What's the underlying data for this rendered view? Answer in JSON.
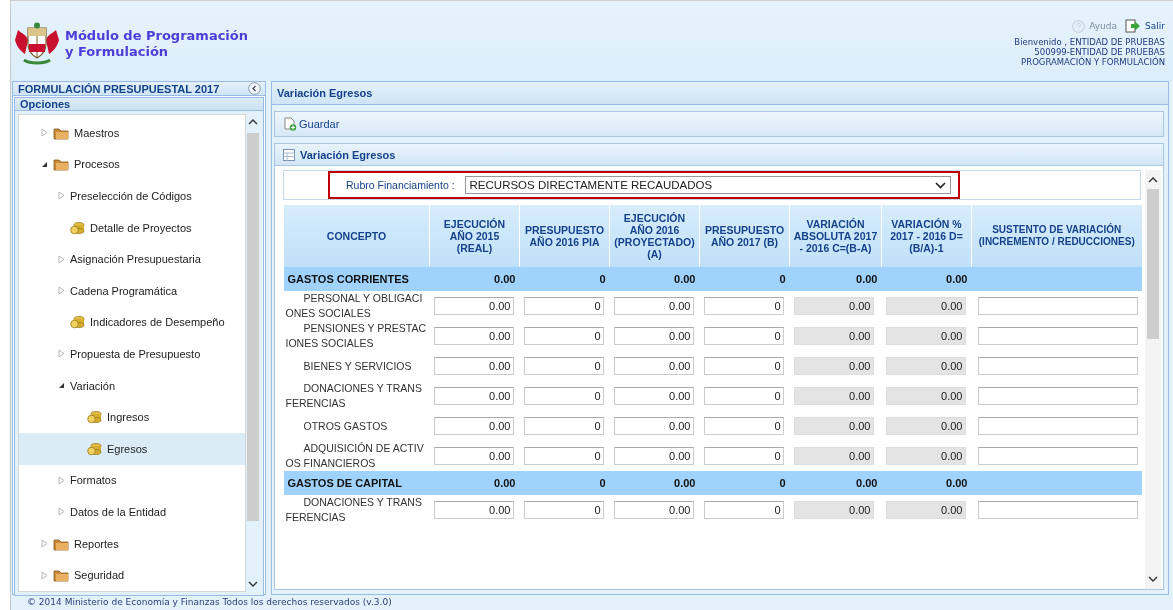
{
  "header": {
    "title": "Módulo de Programación y Formulación",
    "links": [
      {
        "label": "Ayuda",
        "kind": "help",
        "disabled": true
      },
      {
        "label": "Salir",
        "kind": "exit",
        "disabled": false
      }
    ],
    "user_lines": [
      "Bienvenido , ENTIDAD DE PRUEBAS",
      "500999-ENTIDAD DE PRUEBAS",
      "PROGRAMACIÓN Y FORMULACIÓN"
    ]
  },
  "sidebar": {
    "title": "FORMULACIÓN PRESUPUESTAL 2017",
    "section": "Opciones",
    "items": [
      {
        "label": "Maestros",
        "kind": "module",
        "expanded": false,
        "selected": false
      },
      {
        "label": "Procesos",
        "kind": "module",
        "expanded": true,
        "selected": false,
        "children": [
          {
            "label": "Preselección de Códigos",
            "kind": "group",
            "expanded": false,
            "selected": false
          },
          {
            "label": "Detalle de Proyectos",
            "kind": "page",
            "selected": false
          },
          {
            "label": "Asignación Presupuestaria",
            "kind": "group",
            "expanded": false,
            "selected": false
          },
          {
            "label": "Cadena Programática",
            "kind": "group",
            "expanded": false,
            "selected": false
          },
          {
            "label": "Indicadores de Desempeño",
            "kind": "page",
            "selected": false
          },
          {
            "label": "Propuesta de Presupuesto",
            "kind": "group",
            "expanded": false,
            "selected": false
          },
          {
            "label": "Variación",
            "kind": "group",
            "expanded": true,
            "selected": false,
            "children": [
              {
                "label": "Ingresos",
                "kind": "page",
                "selected": false
              },
              {
                "label": "Egresos",
                "kind": "page",
                "selected": true
              }
            ]
          },
          {
            "label": "Formatos",
            "kind": "group",
            "expanded": false,
            "selected": false
          },
          {
            "label": "Datos de la Entidad",
            "kind": "group",
            "expanded": false,
            "selected": false
          }
        ]
      },
      {
        "label": "Reportes",
        "kind": "module",
        "expanded": false,
        "selected": false
      },
      {
        "label": "Seguridad",
        "kind": "module",
        "expanded": false,
        "selected": false
      }
    ]
  },
  "main": {
    "title": "Variación Egresos",
    "toolbar": [
      {
        "label": "Guardar",
        "kind": "save"
      }
    ],
    "panel_title": "Variación Egresos",
    "filter": {
      "label": "Rubro Financiamiento :",
      "value": "RECURSOS DIRECTAMENTE RECAUDADOS"
    },
    "table": {
      "columns": [
        {
          "label": "CONCEPTO",
          "kind": "text"
        },
        {
          "label": "EJECUCIÓN AÑO 2015 (REAL)",
          "kind": "input"
        },
        {
          "label": "PRESUPUESTO AÑO 2016 PIA",
          "kind": "input"
        },
        {
          "label": "EJECUCIÓN AÑO 2016 (PROYECTADO) (A)",
          "kind": "input"
        },
        {
          "label": "PRESUPUESTO AÑO 2017 (B)",
          "kind": "input"
        },
        {
          "label": "VARIACIÓN ABSOLUTA 2017 - 2016 C=(B-A)",
          "kind": "computed"
        },
        {
          "label": "VARIACIÓN % 2017 - 2016 D=(B/A)-1",
          "kind": "computed"
        },
        {
          "label": "SUSTENTO DE VARIACIÓN (INCREMENTO / REDUCCIONES)",
          "kind": "note"
        }
      ],
      "rows": [
        {
          "kind": "group",
          "concept": "GASTOS CORRIENTES",
          "values": [
            "0.00",
            "0",
            "0.00",
            "0",
            "0.00",
            "0.00"
          ]
        },
        {
          "kind": "item",
          "concept": "PERSONAL Y OBLIGACIONES SOCIALES",
          "values": [
            "0.00",
            "0",
            "0.00",
            "0",
            "0.00",
            "0.00"
          ]
        },
        {
          "kind": "item",
          "concept": "PENSIONES Y PRESTACIONES SOCIALES",
          "values": [
            "0.00",
            "0",
            "0.00",
            "0",
            "0.00",
            "0.00"
          ]
        },
        {
          "kind": "item",
          "concept": "BIENES Y SERVICIOS",
          "values": [
            "0.00",
            "0",
            "0.00",
            "0",
            "0.00",
            "0.00"
          ]
        },
        {
          "kind": "item",
          "concept": "DONACIONES Y TRANSFERENCIAS",
          "values": [
            "0.00",
            "0",
            "0.00",
            "0",
            "0.00",
            "0.00"
          ]
        },
        {
          "kind": "item",
          "concept": "OTROS GASTOS",
          "values": [
            "0.00",
            "0",
            "0.00",
            "0",
            "0.00",
            "0.00"
          ]
        },
        {
          "kind": "item",
          "concept": "ADQUISICIÓN DE ACTIVOS FINANCIEROS",
          "values": [
            "0.00",
            "0",
            "0.00",
            "0",
            "0.00",
            "0.00"
          ]
        },
        {
          "kind": "group",
          "concept": "GASTOS DE CAPITAL",
          "values": [
            "0.00",
            "0",
            "0.00",
            "0",
            "0.00",
            "0.00"
          ]
        },
        {
          "kind": "item",
          "concept": "DONACIONES Y TRANSFERENCIAS",
          "values": [
            "0.00",
            "0",
            "0.00",
            "0",
            "0.00",
            "0.00"
          ]
        }
      ]
    }
  },
  "footer": "© 2014 Ministerio de Economía y Finanzas Todos los derechos reservados (v.3.0)"
}
